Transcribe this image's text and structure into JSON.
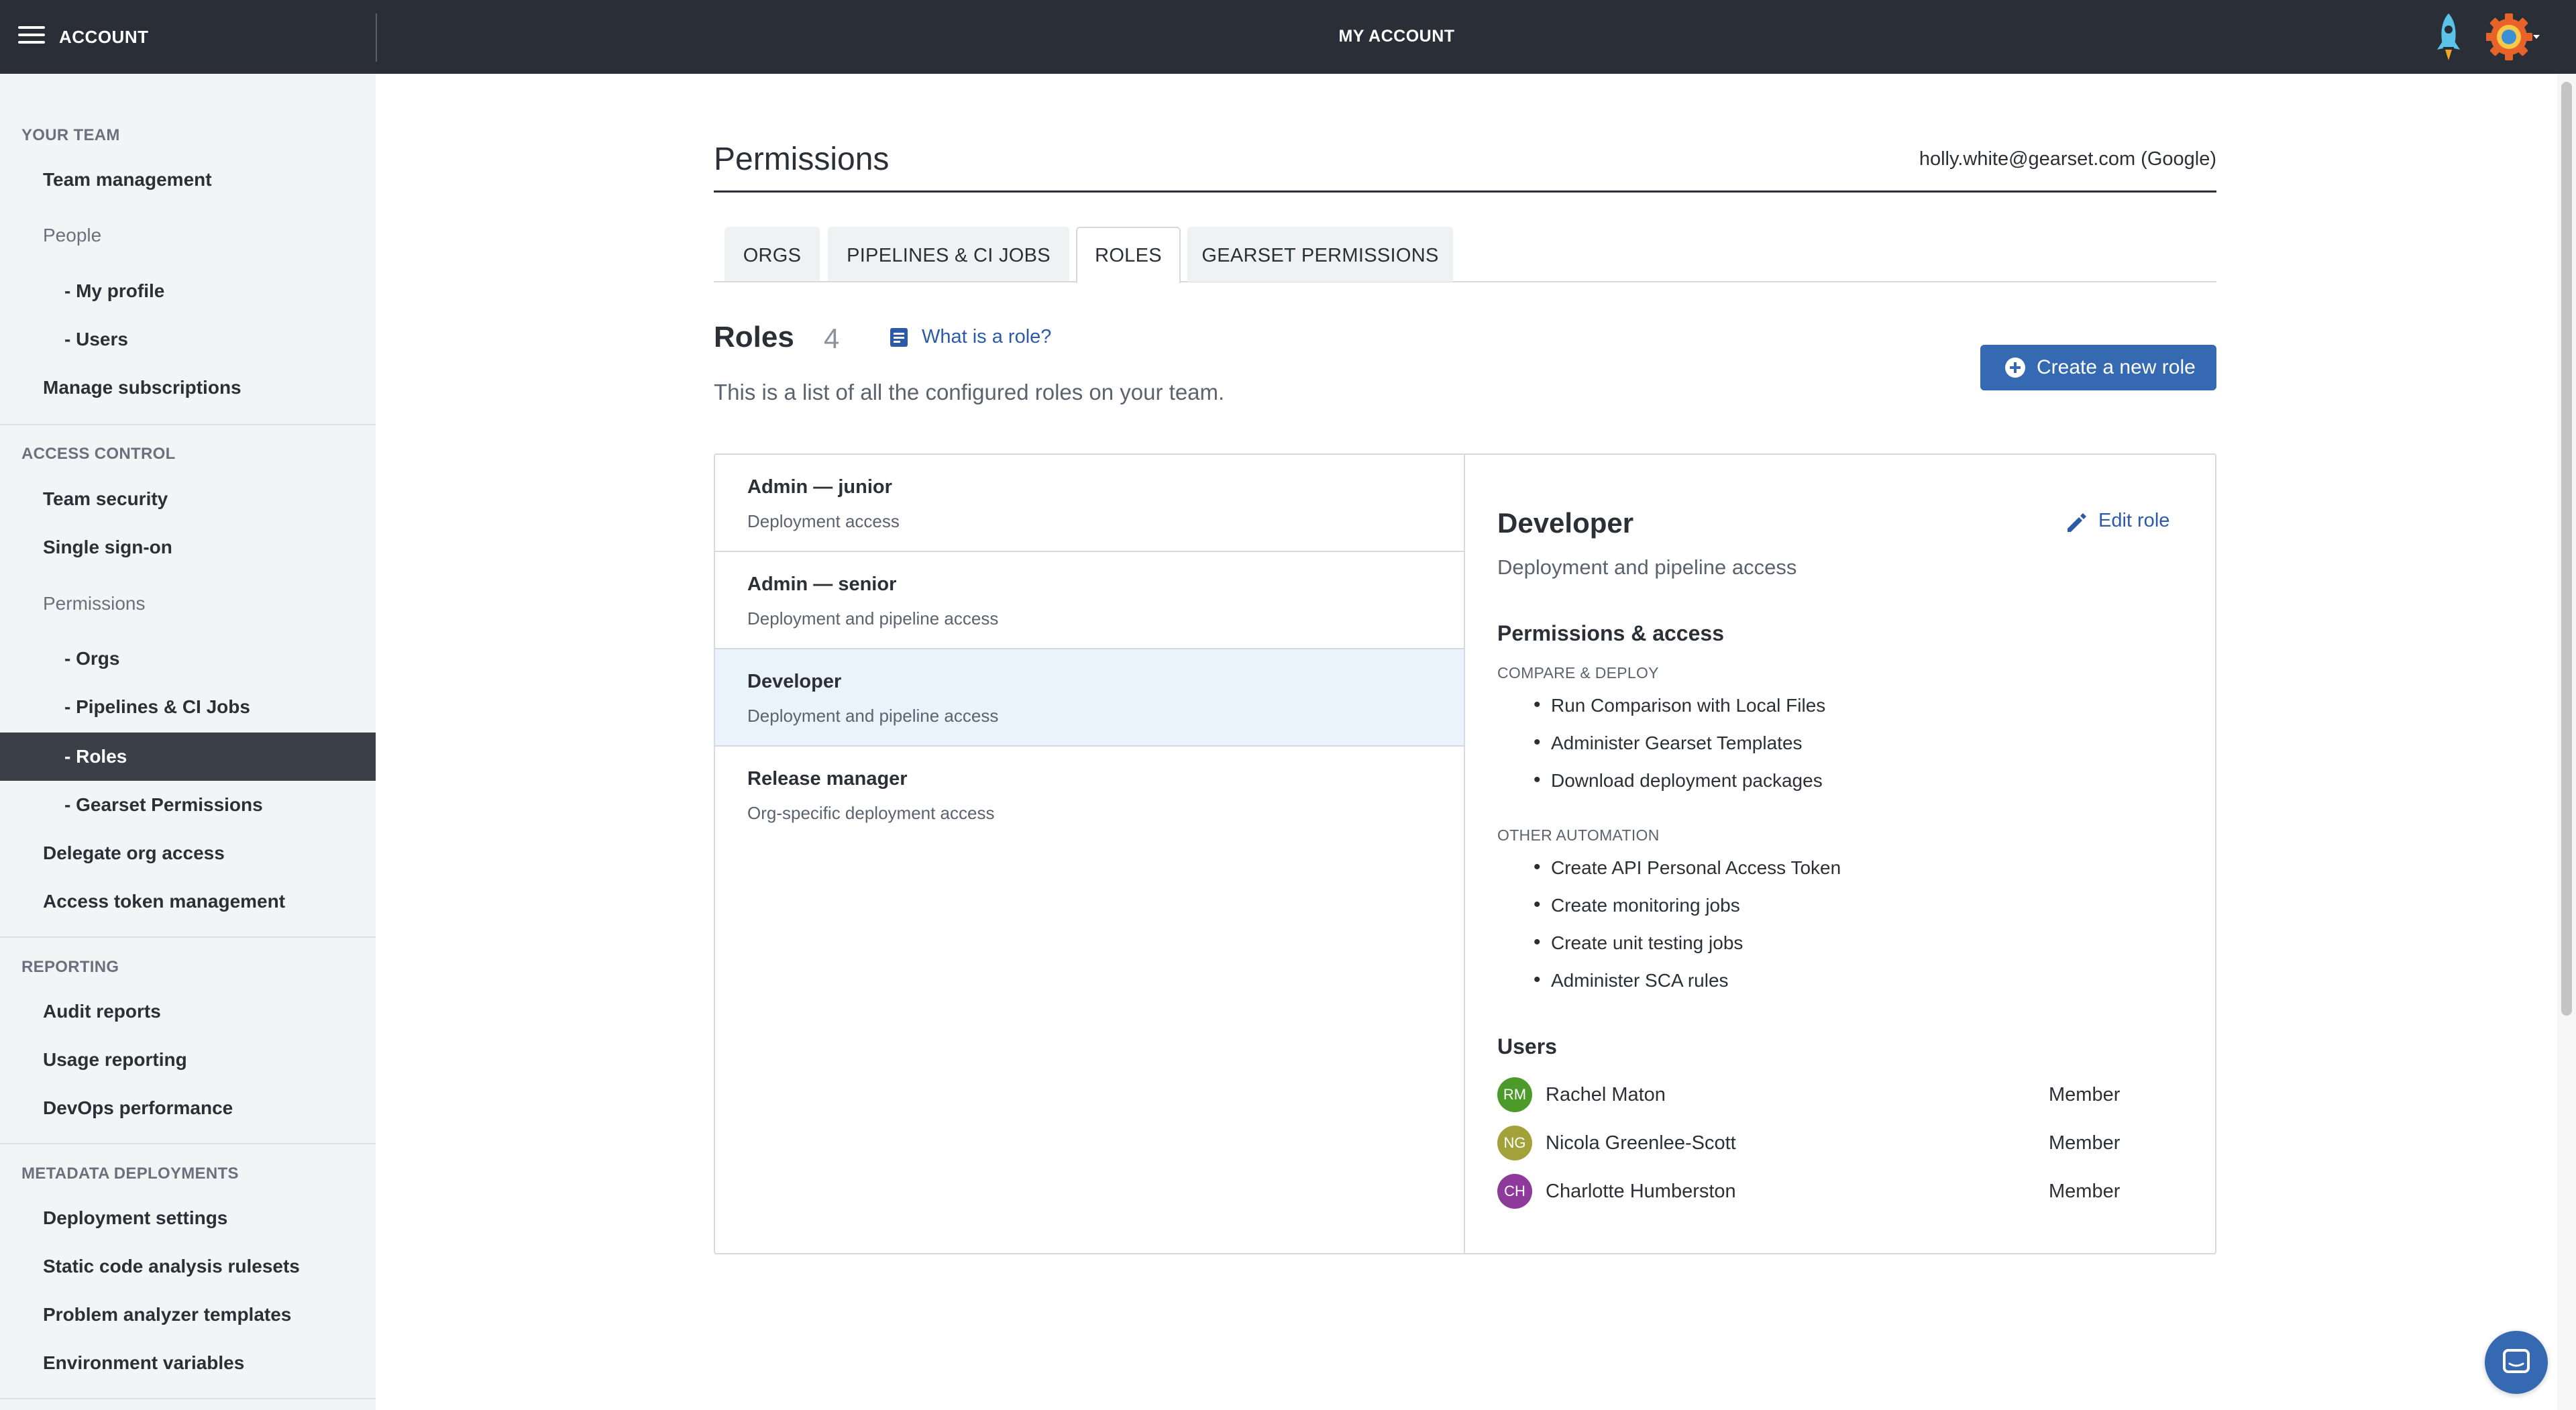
{
  "header": {
    "app_title": "ACCOUNT",
    "center_title": "MY ACCOUNT"
  },
  "sidebar": {
    "sections": {
      "your_team": "YOUR TEAM",
      "access_control": "ACCESS CONTROL",
      "reporting": "REPORTING",
      "metadata_deployments": "METADATA DEPLOYMENTS"
    },
    "items": {
      "team_management": "Team management",
      "people": "People",
      "my_profile": "- My profile",
      "users": "- Users",
      "manage_subscriptions": "Manage subscriptions",
      "team_security": "Team security",
      "single_sign_on": "Single sign-on",
      "permissions": "Permissions",
      "orgs": "- Orgs",
      "pipelines": "- Pipelines & CI Jobs",
      "roles": "- Roles",
      "gearset_permissions": "- Gearset Permissions",
      "delegate_org_access": "Delegate org access",
      "access_token_management": "Access token management",
      "audit_reports": "Audit reports",
      "usage_reporting": "Usage reporting",
      "devops_performance": "DevOps performance",
      "deployment_settings": "Deployment settings",
      "static_code_analysis": "Static code analysis rulesets",
      "problem_analyzer": "Problem analyzer templates",
      "environment_variables": "Environment variables"
    }
  },
  "main": {
    "title": "Permissions",
    "user_email": "holly.white@gearset.com (Google)",
    "tabs": [
      "ORGS",
      "PIPELINES & CI JOBS",
      "ROLES",
      "GEARSET PERMISSIONS"
    ],
    "active_tab": "ROLES",
    "roles_heading": "Roles",
    "roles_count": "4",
    "help_link": "What is a role?",
    "description": "This is a list of all the configured roles on your team.",
    "create_button": "Create a new role"
  },
  "roles": [
    {
      "name": "Admin — junior",
      "subtitle": "Deployment access"
    },
    {
      "name": "Admin — senior",
      "subtitle": "Deployment and pipeline access"
    },
    {
      "name": "Developer",
      "subtitle": "Deployment and pipeline access"
    },
    {
      "name": "Release manager",
      "subtitle": "Org-specific deployment access"
    }
  ],
  "detail": {
    "title": "Developer",
    "subtitle": "Deployment and pipeline access",
    "edit_label": "Edit role",
    "permissions_heading": "Permissions & access",
    "categories": [
      {
        "label": "COMPARE & DEPLOY",
        "items": [
          "Run Comparison with Local Files",
          "Administer Gearset Templates",
          "Download deployment packages"
        ]
      },
      {
        "label": "OTHER AUTOMATION",
        "items": [
          "Create API Personal Access Token",
          "Create monitoring jobs",
          "Create unit testing jobs",
          "Administer SCA rules"
        ]
      }
    ],
    "users_heading": "Users",
    "users": [
      {
        "initials": "RM",
        "name": "Rachel Maton",
        "role": "Member",
        "color": "#4c9a2a"
      },
      {
        "initials": "NG",
        "name": "Nicola Greenlee-Scott",
        "role": "Member",
        "color": "#a3a23a"
      },
      {
        "initials": "CH",
        "name": "Charlotte Humberston",
        "role": "Member",
        "color": "#8e3a9a"
      }
    ]
  },
  "colors": {
    "topbar": "#2a2f37",
    "accent": "#3569b2",
    "link": "#2d5aa8",
    "selected_row": "#eaf3fb"
  },
  "icons": {
    "menu": "hamburger-icon",
    "rocket": "rocket-icon",
    "avatar": "gear-avatar-icon",
    "help": "document-icon",
    "create": "plus-circle-icon",
    "edit": "pencil-icon",
    "chat": "chat-icon"
  }
}
